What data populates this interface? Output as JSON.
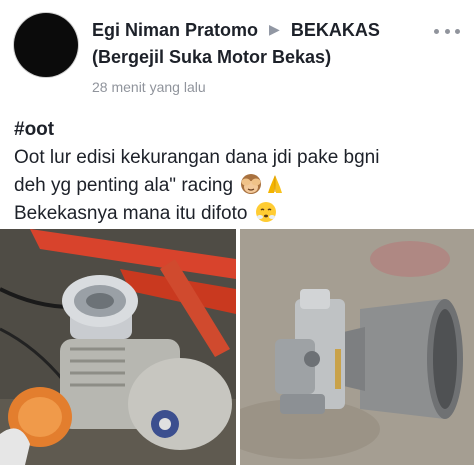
{
  "post": {
    "author": "Egi Niman Pratomo",
    "group_name": "BEKAKAS",
    "group_full": "(Bergejil Suka Motor Bekas)",
    "timestamp": "28 menit yang lalu",
    "hashtag": "#oot",
    "lines": [
      "Oot lur edisi kekurangan dana jdi pake bgni",
      "deh yg penting ala\" racing",
      "Bekekasnya mana itu difoto"
    ],
    "emojis": [
      "see-no-evil-monkey",
      "folded-hands",
      "face-with-steam"
    ]
  },
  "photos": [
    {
      "name": "motorcycle-engine-photo"
    },
    {
      "name": "carburetor-pvc-pipe-photo"
    }
  ],
  "colors": {
    "text": "#1d2129",
    "muted": "#90949c",
    "frame_red": "#d8432c"
  }
}
